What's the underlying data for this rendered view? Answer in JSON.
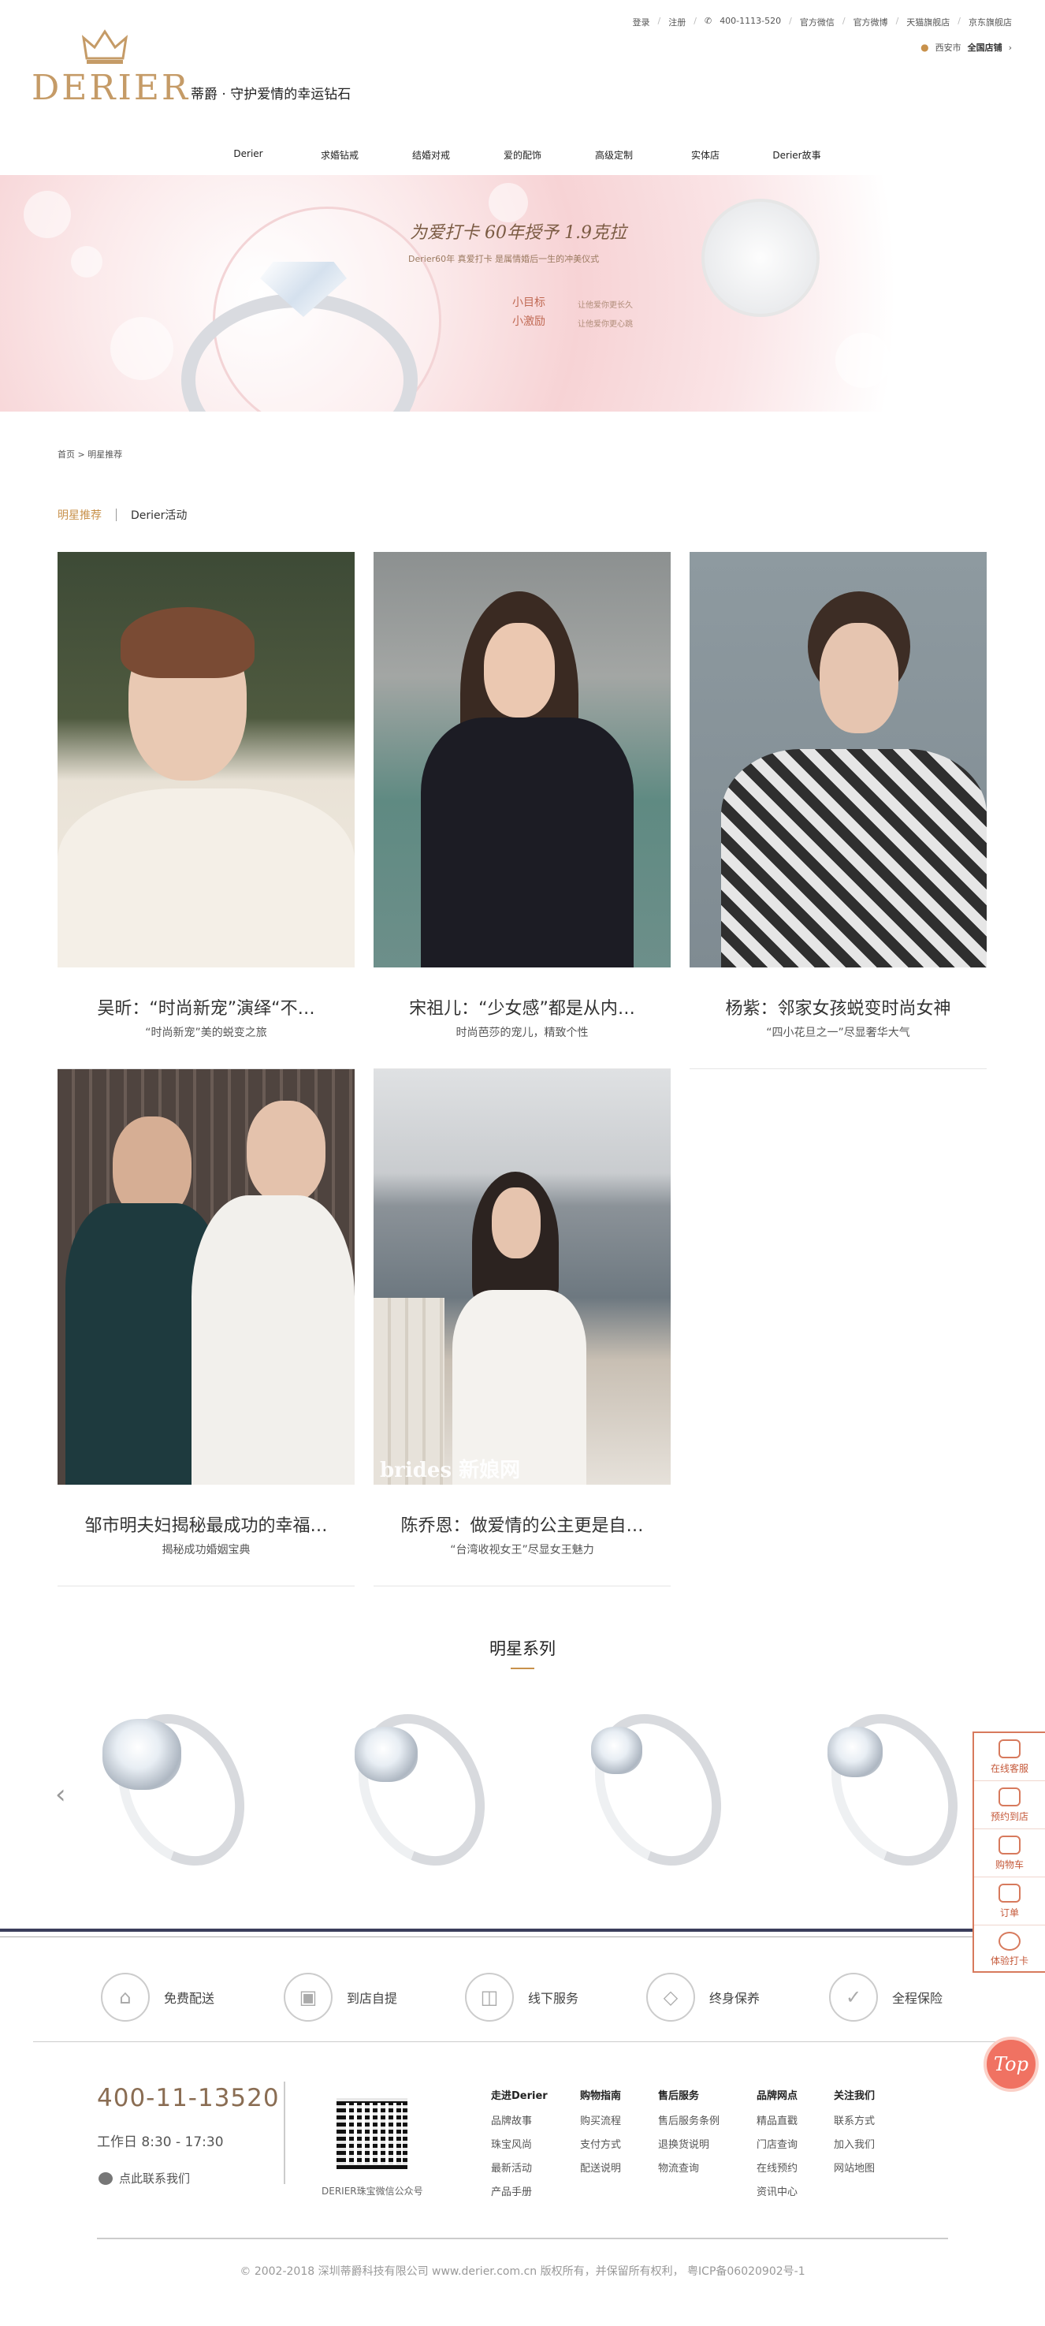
{
  "header": {
    "topbar": [
      "登录",
      "注册",
      "400-1113-520",
      "官方微信",
      "官方微博",
      "天猫旗舰店",
      "京东旗舰店"
    ],
    "location_city": "西安市",
    "location_store": "全国店铺",
    "logo_text": "DERIER",
    "slogan": "蒂爵 · 守护爱情的幸运钻石",
    "nav": [
      "Derier",
      "求婚钻戒",
      "结婚对戒",
      "爱的配饰",
      "高级定制",
      "实体店",
      "Derier故事"
    ]
  },
  "banner": {
    "line1": "为爱打卡 60年授予 1.9克拉",
    "line2": "Derier60年  真爱打卡  是属情婚后一生的冲美仪式",
    "line3a": "小目标",
    "line3b": "小激励",
    "line4a": "让他爱你更长久",
    "line4b": "让他爱你更心跳"
  },
  "breadcrumb": {
    "home": "首页",
    "sep": ">",
    "current": "明星推荐"
  },
  "tabs": {
    "active": "明星推荐",
    "other": "Derier活动"
  },
  "cards": [
    {
      "title": "吴昕：“时尚新宠”演绎“不…",
      "sub": "“时尚新宠”美的蜕变之旅",
      "photo_colors": [
        "#3d4a36",
        "#f1ece3"
      ]
    },
    {
      "title": "宋祖儿：“少女感”都是从内…",
      "sub": "时尚芭莎的宠儿，精致个性",
      "photo_colors": [
        "#7f8585",
        "#1c1c24"
      ]
    },
    {
      "title": "杨紫：邻家女孩蜕变时尚女神",
      "sub": "“四小花旦之一”尽显奢华大气",
      "photo_colors": [
        "#8a969c",
        "#3b3b3b"
      ]
    },
    {
      "title": "邹市明夫妇揭秘最成功的幸福…",
      "sub": "揭秘成功婚姻宝典",
      "photo_colors": [
        "#5a4b43",
        "#f0eeea"
      ]
    },
    {
      "title": "陈乔恩：做爱情的公主更是自…",
      "sub": "“台湾收视女王”尽显女王魅力",
      "photo_colors": [
        "#b7bcc0",
        "#f1eeea"
      ]
    }
  ],
  "photo_tags": [
    "",
    "",
    "",
    "",
    "brides 新娘网"
  ],
  "series": {
    "title": "明星系列",
    "products": 4
  },
  "services": [
    "免费配送",
    "到店自提",
    "线下服务",
    "终身保养",
    "全程保险"
  ],
  "footer": {
    "phone": "400-11-13520",
    "hours": "工作日 8:30 - 17:30",
    "contact": "点此联系我们",
    "qr_label": "DERIER珠宝微信公众号",
    "columns": [
      {
        "head": "走进Derier",
        "items": [
          "品牌故事",
          "珠宝风尚",
          "最新活动",
          "产品手册"
        ]
      },
      {
        "head": "购物指南",
        "items": [
          "购买流程",
          "支付方式",
          "配送说明"
        ]
      },
      {
        "head": "售后服务",
        "items": [
          "售后服务条例",
          "退换货说明",
          "物流查询"
        ]
      },
      {
        "head": "品牌网点",
        "items": [
          "精品直戳",
          "门店查询",
          "在线预约",
          "资讯中心"
        ]
      },
      {
        "head": "关注我们",
        "items": [
          "联系方式",
          "加入我们",
          "网站地图"
        ]
      }
    ],
    "copyright": "© 2002-2018 深圳蒂爵科技有限公司 www.derier.com.cn 版权所有，并保留所有权利， 粤ICP备06020902号-1"
  },
  "sidebar": [
    "在线客服",
    "预约到店",
    "购物车",
    "订单",
    "体验打卡"
  ],
  "top_button": "Top",
  "colors": {
    "accent": "#c8914b",
    "side": "#d77a5d"
  }
}
